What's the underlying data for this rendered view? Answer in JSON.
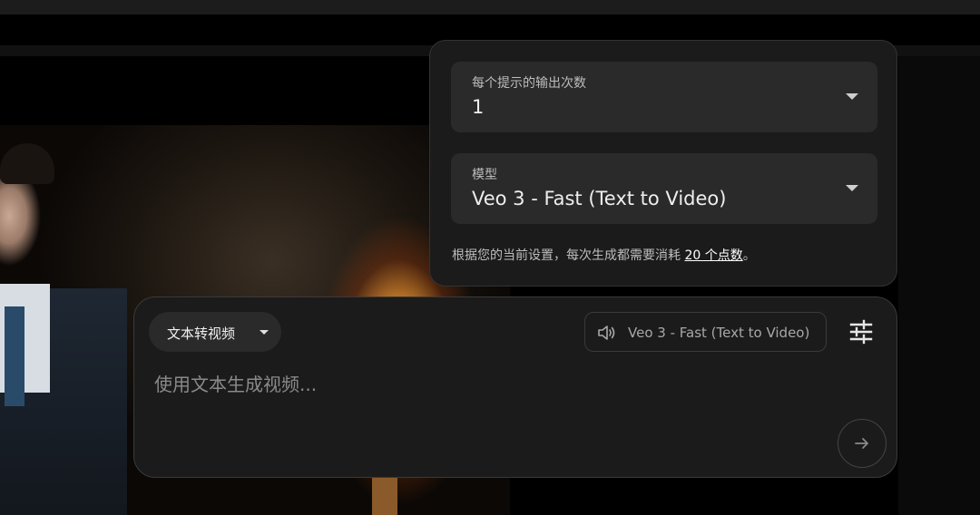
{
  "settings": {
    "outputs_field": {
      "label": "每个提示的输出次数",
      "value": "1"
    },
    "model_field": {
      "label": "模型",
      "value": "Veo 3 - Fast (Text to Video)"
    },
    "credits_note": {
      "prefix": "根据您的当前设置，每次生成都需要消耗 ",
      "link": "20 个点数",
      "suffix": "。"
    }
  },
  "composer": {
    "mode_label": "文本转视频",
    "model_chip_label": "Veo 3 - Fast (Text to Video)",
    "prompt_placeholder": "使用文本生成视频..."
  },
  "icons": {
    "dropdown": "caret-down-icon",
    "speaker": "volume-icon",
    "tune": "tune-sliders-icon",
    "send": "arrow-right-icon"
  },
  "colors": {
    "panel_bg": "#1b1b1b",
    "field_bg": "#2a2a2a",
    "text_primary": "#eeeeee",
    "text_secondary": "#bdbdbd"
  }
}
